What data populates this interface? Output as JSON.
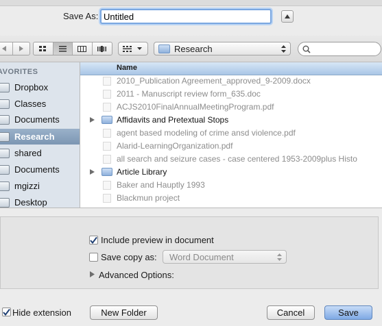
{
  "save_as": {
    "label": "Save As:",
    "value": "Untitled"
  },
  "toolbar": {
    "location": "Research",
    "view_modes": [
      "icon-view",
      "list-view",
      "column-view",
      "cover-flow-view"
    ],
    "active_view": "list-view",
    "search_placeholder": ""
  },
  "sidebar": {
    "heading": "AVORITES",
    "items": [
      {
        "label": "Dropbox",
        "icon": "folder-icon"
      },
      {
        "label": "Classes",
        "icon": "folder-icon"
      },
      {
        "label": "Documents",
        "icon": "folder-icon"
      },
      {
        "label": "Research",
        "icon": "folder-icon",
        "selected": true
      },
      {
        "label": "shared",
        "icon": "folder-icon"
      },
      {
        "label": "Documents",
        "icon": "documents-folder-icon"
      },
      {
        "label": "mgizzi",
        "icon": "home-icon"
      },
      {
        "label": "Desktop",
        "icon": "desktop-icon"
      }
    ]
  },
  "file_list": {
    "column_header": "Name",
    "rows": [
      {
        "name": "2010_Publication Agreement_approved_9-2009.docx",
        "type": "file"
      },
      {
        "name": "2011 - Manuscript review form_635.doc",
        "type": "file"
      },
      {
        "name": "ACJS2010FinalAnnualMeetingProgram.pdf",
        "type": "file"
      },
      {
        "name": "Affidavits and Pretextual Stops",
        "type": "folder"
      },
      {
        "name": "agent based modeling of crime ansd violence.pdf",
        "type": "file"
      },
      {
        "name": "Alarid-LearningOrganization.pdf",
        "type": "file"
      },
      {
        "name": "all search and seizure cases - case centered 1953-2009plus Histo",
        "type": "file"
      },
      {
        "name": "Article Library",
        "type": "folder"
      },
      {
        "name": "Baker and Hauptly 1993",
        "type": "file"
      },
      {
        "name": "Blackmun project",
        "type": "file"
      }
    ]
  },
  "options": {
    "include_preview_label": "Include preview in document",
    "include_preview_checked": true,
    "save_copy_label": "Save copy as:",
    "save_copy_checked": false,
    "save_copy_format": "Word Document",
    "advanced_label": "Advanced Options:"
  },
  "footer": {
    "hide_extension_label": "Hide extension",
    "hide_extension_checked": true,
    "new_folder_label": "New Folder",
    "cancel_label": "Cancel",
    "save_label": "Save"
  }
}
